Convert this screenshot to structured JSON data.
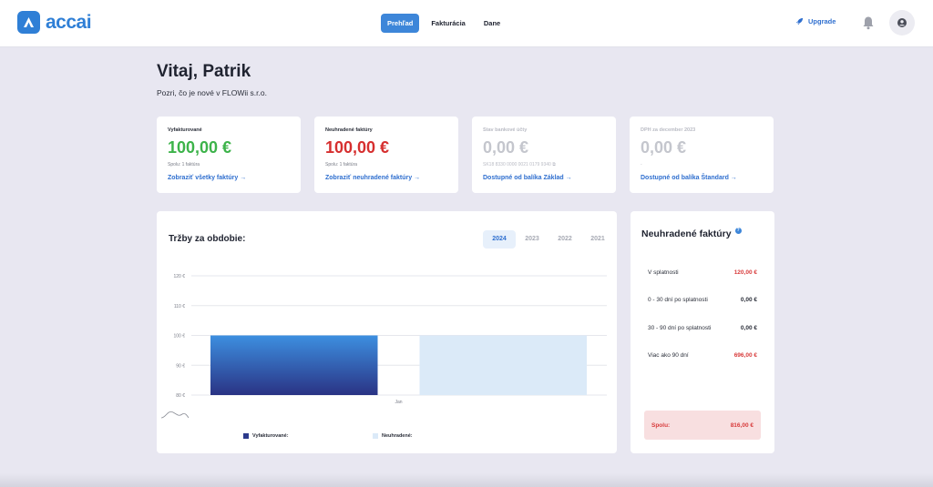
{
  "app": {
    "brand": "accai"
  },
  "nav": [
    {
      "label": "Prehľad",
      "active": true
    },
    {
      "label": "Fakturácia",
      "active": false
    },
    {
      "label": "Dane",
      "active": false
    }
  ],
  "header": {
    "upgrade_label": "Upgrade",
    "upgrade_icon": "rocket-icon",
    "bell_icon": "bell-icon",
    "avatar_icon": "user-icon"
  },
  "greeting": {
    "title": "Vitaj, Patrik",
    "subtitle": "Pozri, čo je nové v FLOWii s.r.o."
  },
  "stats": [
    {
      "label": "Vyfakturované",
      "value": "100,00 €",
      "meta": "Spolu: 1 faktúra",
      "link": "Zobraziť všetky faktúry →",
      "color": "#3db34a"
    },
    {
      "label": "Neuhradené faktúry",
      "value": "100,00 €",
      "meta": "Spolu: 1 faktúra",
      "link": "Zobraziť neuhradené faktúry →",
      "color": "#d62f2f"
    },
    {
      "label": "Stav bankové účty",
      "value": "0,00 €",
      "meta": "SK18 8330 0000 0021 0179 9340",
      "link": "Dostupné od balíka Základ →",
      "color": "#c4c6cd"
    },
    {
      "label": "DPH za december 2023",
      "value": "0,00 €",
      "meta": "-",
      "link": "Dostupné od balíka Štandard →",
      "color": "#c4c6cd"
    }
  ],
  "revenue": {
    "title": "Tržby za obdobie:",
    "years": [
      "2024",
      "2023",
      "2022",
      "2021"
    ],
    "active_year": "2024"
  },
  "chart_data": {
    "type": "bar",
    "categories": [
      "Jan"
    ],
    "y_ticks": [
      "120 €",
      "110 €",
      "100 €",
      "90 €",
      "80 €"
    ],
    "ylim": [
      80,
      120
    ],
    "series": [
      {
        "name": "Vyfakturované:",
        "values": [
          100
        ],
        "color": "#2c3a8c"
      },
      {
        "name": "Neuhradené:",
        "values": [
          100
        ],
        "color": "#dbeaf8"
      }
    ],
    "legend": "bottom"
  },
  "unpaid": {
    "title": "Neuhradené faktúry",
    "rows": [
      {
        "label": "V splatnosti",
        "amount": "120,00 €",
        "red": true
      },
      {
        "label": "0 - 30 dní po splatnosti",
        "amount": "0,00 €",
        "red": false
      },
      {
        "label": "30 - 90 dní po splatnosti",
        "amount": "0,00 €",
        "red": false
      },
      {
        "label": "Viac ako 90 dní",
        "amount": "696,00 €",
        "red": true
      }
    ],
    "total_label": "Spolu:",
    "total_amount": "816,00 €"
  }
}
